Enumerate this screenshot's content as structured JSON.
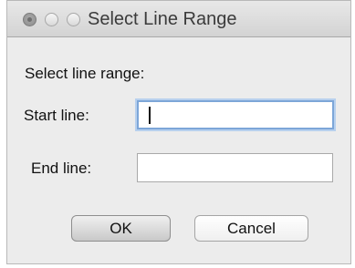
{
  "window": {
    "title": "Select Line Range"
  },
  "dialog": {
    "heading": "Select line range:",
    "start_label": "Start line:",
    "start_value": "",
    "end_label": "End line:",
    "end_value": ""
  },
  "buttons": {
    "ok_label": "OK",
    "cancel_label": "Cancel"
  },
  "colors": {
    "focus_ring": "#7da6d8",
    "window_bg": "#ececec"
  }
}
